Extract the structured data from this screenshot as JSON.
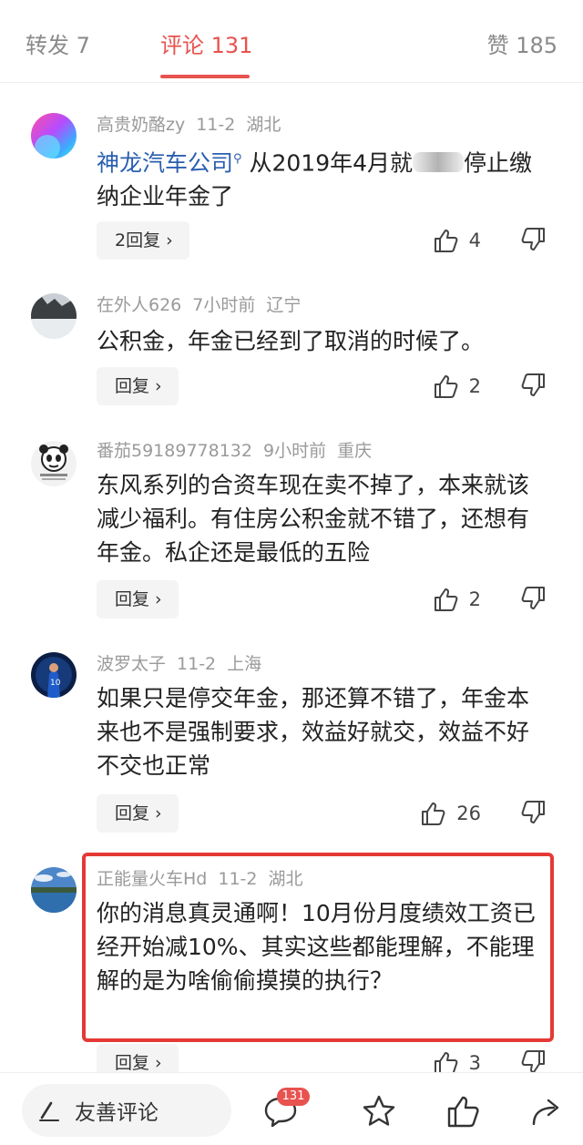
{
  "tabs": {
    "reposts": "转发 7",
    "comments": "评论 131",
    "likes": "赞 185"
  },
  "comments": [
    {
      "user": "高贵奶酪zy",
      "time": "11-2",
      "location": "湖北",
      "topic": "神龙汽车公司",
      "text_before_blur": "从2019年4月就",
      "text_after_blur": "停止缴纳企业年金了",
      "reply_label": "2回复",
      "likes": "4"
    },
    {
      "user": "在外人626",
      "time": "7小时前",
      "location": "辽宁",
      "text": "公积金，年金已经到了取消的时候了。",
      "reply_label": "回复",
      "likes": "2"
    },
    {
      "user": "番茄59189778132",
      "time": "9小时前",
      "location": "重庆",
      "text": "东风系列的合资车现在卖不掉了，本来就该减少福利。有住房公积金就不错了，还想有年金。私企还是最低的五险",
      "reply_label": "回复",
      "likes": "2"
    },
    {
      "user": "波罗太子",
      "time": "11-2",
      "location": "上海",
      "text": "如果只是停交年金，那还算不错了，年金本来也不是强制要求，效益好就交，效益不好不交也正常",
      "reply_label": "回复",
      "likes": "26"
    },
    {
      "user": "正能量火车Hd",
      "time": "11-2",
      "location": "湖北",
      "text": "你的消息真灵通啊！10月份月度绩效工资已经开始减10%、其实这些都能理解，不能理解的是为啥偷偷摸摸的执行？",
      "reply_label": "回复",
      "likes": "3"
    }
  ],
  "bottom_bar": {
    "input_label": "友善评论",
    "comment_badge": "131"
  },
  "colors": {
    "accent": "#e8524f",
    "topic_link": "#2a5fb0",
    "highlight_border": "#e53935"
  }
}
